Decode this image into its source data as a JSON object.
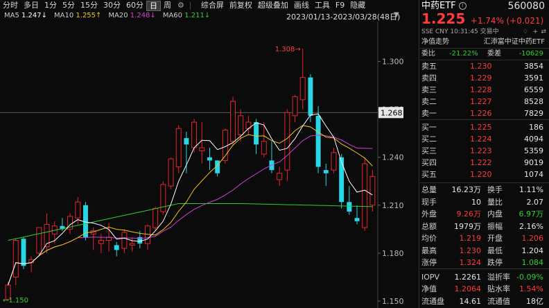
{
  "toolbar": {
    "periods": [
      "分时",
      "多日",
      "1分",
      "5分",
      "15分",
      "30分",
      "60分",
      "日",
      "周"
    ],
    "active": "日",
    "actions": [
      "综合屏",
      "前复权",
      "超级叠加",
      "画线",
      "工具",
      "F9",
      "隐藏"
    ]
  },
  "ma_legend": [
    {
      "label": "MA5",
      "value": "1.247↓",
      "color": "#ffffff"
    },
    {
      "label": "MA10",
      "value": "1.255↑",
      "color": "#f5c518"
    },
    {
      "label": "MA20",
      "value": "1.248↓",
      "color": "#d040d0"
    },
    {
      "label": "MA60",
      "value": "1.211↓",
      "color": "#2fd02f"
    }
  ],
  "date_range": "2023/01/13-2023/03/28(48日)",
  "chart_data": {
    "type": "candlestick",
    "ylim": [
      1.15,
      1.325
    ],
    "y_ticks": [
      "1.300",
      "1.270",
      "1.240",
      "1.210",
      "1.180",
      "1.150"
    ],
    "y_tick_values": [
      1.3,
      1.27,
      1.24,
      1.21,
      1.18,
      1.15
    ],
    "current_price_label": "1.268",
    "current_price_value": 1.268,
    "high_marker": "1.308",
    "low_marker": "1.150",
    "candles": [
      {
        "o": 1.151,
        "h": 1.162,
        "l": 1.15,
        "c": 1.16
      },
      {
        "o": 1.165,
        "h": 1.189,
        "l": 1.16,
        "c": 1.188
      },
      {
        "o": 1.189,
        "h": 1.19,
        "l": 1.17,
        "c": 1.172
      },
      {
        "o": 1.174,
        "h": 1.178,
        "l": 1.168,
        "c": 1.176
      },
      {
        "o": 1.18,
        "h": 1.196,
        "l": 1.178,
        "c": 1.196
      },
      {
        "o": 1.184,
        "h": 1.205,
        "l": 1.18,
        "c": 1.198
      },
      {
        "o": 1.192,
        "h": 1.2,
        "l": 1.186,
        "c": 1.197
      },
      {
        "o": 1.197,
        "h": 1.202,
        "l": 1.194,
        "c": 1.195
      },
      {
        "o": 1.195,
        "h": 1.205,
        "l": 1.192,
        "c": 1.203
      },
      {
        "o": 1.202,
        "h": 1.215,
        "l": 1.198,
        "c": 1.212
      },
      {
        "o": 1.21,
        "h": 1.212,
        "l": 1.188,
        "c": 1.19
      },
      {
        "o": 1.192,
        "h": 1.196,
        "l": 1.182,
        "c": 1.194
      },
      {
        "o": 1.186,
        "h": 1.192,
        "l": 1.18,
        "c": 1.188
      },
      {
        "o": 1.188,
        "h": 1.199,
        "l": 1.181,
        "c": 1.19
      },
      {
        "o": 1.185,
        "h": 1.187,
        "l": 1.178,
        "c": 1.182
      },
      {
        "o": 1.183,
        "h": 1.195,
        "l": 1.18,
        "c": 1.193
      },
      {
        "o": 1.185,
        "h": 1.19,
        "l": 1.181,
        "c": 1.186
      },
      {
        "o": 1.19,
        "h": 1.194,
        "l": 1.183,
        "c": 1.186
      },
      {
        "o": 1.186,
        "h": 1.198,
        "l": 1.182,
        "c": 1.197
      },
      {
        "o": 1.196,
        "h": 1.209,
        "l": 1.194,
        "c": 1.208
      },
      {
        "o": 1.206,
        "h": 1.225,
        "l": 1.204,
        "c": 1.223
      },
      {
        "o": 1.222,
        "h": 1.24,
        "l": 1.22,
        "c": 1.239
      },
      {
        "o": 1.234,
        "h": 1.26,
        "l": 1.23,
        "c": 1.258
      },
      {
        "o": 1.252,
        "h": 1.256,
        "l": 1.23,
        "c": 1.248
      },
      {
        "o": 1.246,
        "h": 1.264,
        "l": 1.243,
        "c": 1.262
      },
      {
        "o": 1.244,
        "h": 1.262,
        "l": 1.236,
        "c": 1.246
      },
      {
        "o": 1.24,
        "h": 1.246,
        "l": 1.232,
        "c": 1.238
      },
      {
        "o": 1.238,
        "h": 1.238,
        "l": 1.228,
        "c": 1.23
      },
      {
        "o": 1.238,
        "h": 1.258,
        "l": 1.236,
        "c": 1.257
      },
      {
        "o": 1.25,
        "h": 1.278,
        "l": 1.247,
        "c": 1.275
      },
      {
        "o": 1.254,
        "h": 1.27,
        "l": 1.25,
        "c": 1.266
      },
      {
        "o": 1.258,
        "h": 1.266,
        "l": 1.254,
        "c": 1.262
      },
      {
        "o": 1.262,
        "h": 1.264,
        "l": 1.242,
        "c": 1.248
      },
      {
        "o": 1.242,
        "h": 1.262,
        "l": 1.24,
        "c": 1.25
      },
      {
        "o": 1.238,
        "h": 1.25,
        "l": 1.23,
        "c": 1.232
      },
      {
        "o": 1.226,
        "h": 1.234,
        "l": 1.222,
        "c": 1.23
      },
      {
        "o": 1.232,
        "h": 1.27,
        "l": 1.225,
        "c": 1.268
      },
      {
        "o": 1.266,
        "h": 1.279,
        "l": 1.262,
        "c": 1.278
      },
      {
        "o": 1.276,
        "h": 1.308,
        "l": 1.27,
        "c": 1.29
      },
      {
        "o": 1.29,
        "h": 1.292,
        "l": 1.262,
        "c": 1.266
      },
      {
        "o": 1.266,
        "h": 1.272,
        "l": 1.23,
        "c": 1.234
      },
      {
        "o": 1.232,
        "h": 1.236,
        "l": 1.222,
        "c": 1.23
      },
      {
        "o": 1.232,
        "h": 1.246,
        "l": 1.23,
        "c": 1.243
      },
      {
        "o": 1.24,
        "h": 1.242,
        "l": 1.208,
        "c": 1.212
      },
      {
        "o": 1.212,
        "h": 1.222,
        "l": 1.204,
        "c": 1.206
      },
      {
        "o": 1.202,
        "h": 1.21,
        "l": 1.198,
        "c": 1.2
      },
      {
        "o": 1.196,
        "h": 1.24,
        "l": 1.194,
        "c": 1.236
      },
      {
        "o": 1.21,
        "h": 1.232,
        "l": 1.206,
        "c": 1.228
      }
    ]
  },
  "panel": {
    "title": "中药ETF",
    "code": "560080",
    "price": "1.225",
    "change": "+1.74%",
    "change_abs": "(+0.021)",
    "meta": "SSE CNY 10:31:45 交易中",
    "nav_label": "净值走势",
    "fund_name": "汇添富中证中药ETF",
    "weibi_label": "委比",
    "weibi": "-21.22%",
    "weicha_label": "委差",
    "weicha": "-10629",
    "asks": [
      {
        "label": "卖五",
        "price": "1.230",
        "vol": "3854"
      },
      {
        "label": "卖四",
        "price": "1.229",
        "vol": "3591"
      },
      {
        "label": "卖三",
        "price": "1.228",
        "vol": "6559"
      },
      {
        "label": "卖二",
        "price": "1.227",
        "vol": "8528"
      },
      {
        "label": "卖一",
        "price": "1.226",
        "vol": "7829"
      }
    ],
    "bids": [
      {
        "label": "买一",
        "price": "1.225",
        "vol": "186"
      },
      {
        "label": "买二",
        "price": "1.224",
        "vol": "4094"
      },
      {
        "label": "买三",
        "price": "1.223",
        "vol": "5359"
      },
      {
        "label": "买四",
        "price": "1.222",
        "vol": "9019"
      },
      {
        "label": "买五",
        "price": "1.220",
        "vol": "1074"
      }
    ],
    "stats": [
      [
        {
          "l": "总量",
          "v": "16.23万",
          "c": "white"
        },
        {
          "l": "换手",
          "v": "1.11%",
          "c": "white"
        }
      ],
      [
        {
          "l": "现手",
          "v": "10",
          "c": "white"
        },
        {
          "l": "量比",
          "v": "2.07",
          "c": "white"
        }
      ],
      [
        {
          "l": "外盘",
          "v": "9.26万",
          "c": "red"
        },
        {
          "l": "内盘",
          "v": "6.97万",
          "c": "green"
        }
      ],
      [
        {
          "l": "总额",
          "v": "1979万",
          "c": "white"
        },
        {
          "l": "振幅",
          "v": "2.16%",
          "c": "white"
        }
      ],
      [
        {
          "l": "均价",
          "v": "1.219",
          "c": "red"
        },
        {
          "l": "开盘",
          "v": "1.206",
          "c": "red"
        }
      ],
      [
        {
          "l": "最高",
          "v": "1.230",
          "c": "red"
        },
        {
          "l": "最低",
          "v": "1.204",
          "c": "white"
        }
      ],
      [
        {
          "l": "涨停",
          "v": "1.324",
          "c": "red"
        },
        {
          "l": "跌停",
          "v": "1.084",
          "c": "green"
        }
      ]
    ],
    "stats2": [
      [
        {
          "l": "IOPV",
          "v": "1.2261",
          "c": "white"
        },
        {
          "l": "溢折率",
          "v": "-0.09%",
          "c": "green"
        }
      ],
      [
        {
          "l": "净值",
          "v": "1.2064",
          "c": "red"
        },
        {
          "l": "贴水率",
          "v": "1.54%",
          "c": "red"
        }
      ],
      [
        {
          "l": "流通盘",
          "v": "14.61",
          "c": "white"
        },
        {
          "l": "流通值",
          "v": "18亿",
          "c": "white"
        }
      ]
    ]
  },
  "colors": {
    "up": "#e8242d",
    "down": "#29d6e6",
    "ma5": "#ffffff",
    "ma10": "#f5c518",
    "ma20": "#d040d0",
    "ma60": "#2fd02f"
  }
}
